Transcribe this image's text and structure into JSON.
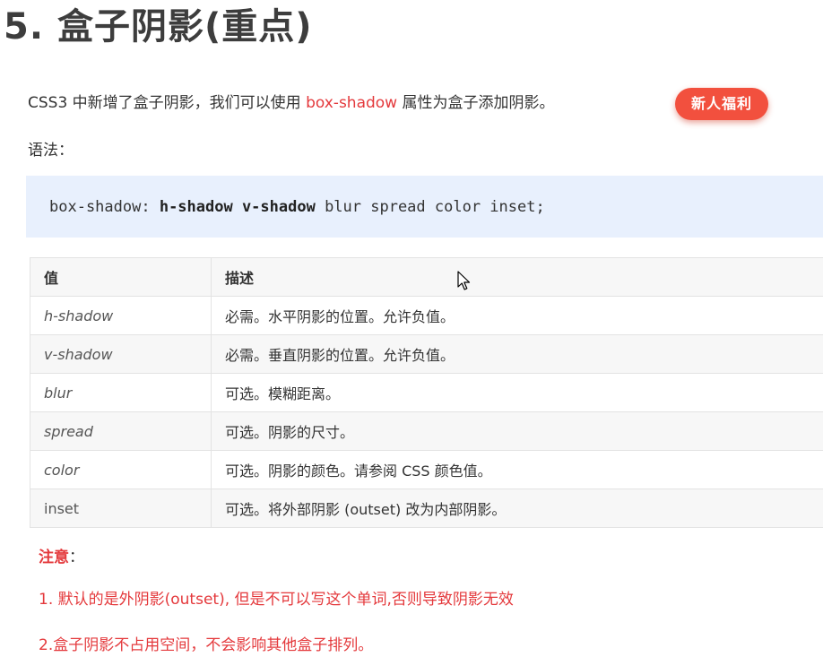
{
  "heading": "5. 盒子阴影(重点)",
  "intro": {
    "before": "CSS3 中新增了盒子阴影，我们可以使用 ",
    "keyword": "box-shadow",
    "after": " 属性为盒子添加阴影。",
    "badge": "新人福利"
  },
  "syntax": {
    "label": "语法：",
    "code_prefix": "box-shadow: ",
    "code_bold": "h-shadow v-shadow",
    "code_suffix": " blur spread color inset;"
  },
  "table": {
    "headers": [
      "值",
      "描述"
    ],
    "rows": [
      {
        "value": "h-shadow",
        "description": "必需。水平阴影的位置。允许负值。"
      },
      {
        "value": "v-shadow",
        "description": "必需。垂直阴影的位置。允许负值。"
      },
      {
        "value": "blur",
        "description": "可选。模糊距离。"
      },
      {
        "value": "spread",
        "description": "可选。阴影的尺寸。"
      },
      {
        "value": "color",
        "description": "可选。阴影的颜色。请参阅 CSS 颜色值。"
      },
      {
        "value": "inset",
        "description": "可选。将外部阴影 (outset) 改为内部阴影。"
      }
    ]
  },
  "notes": {
    "label": "注意",
    "colon": "：",
    "items": [
      "1. 默认的是外阴影(outset), 但是不可以写这个单词,否则导致阴影无效",
      "2.盒子阴影不占用空间，不会影响其他盒子排列。"
    ]
  },
  "colors": {
    "accent_red": "#e4393c",
    "badge_bg": "#f2503e",
    "code_bg": "#e8f0fd"
  },
  "icons": {
    "cursor": "mouse-pointer-icon"
  }
}
